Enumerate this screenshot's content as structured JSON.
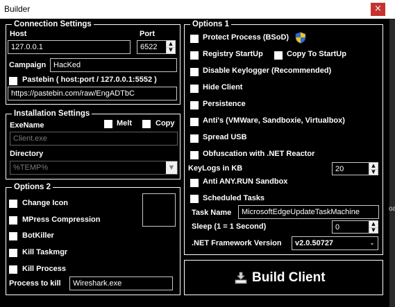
{
  "window": {
    "title": "Builder",
    "close_glyph": "×"
  },
  "edge_text": "oac",
  "connection": {
    "title": "Connection Settings",
    "host_label": "Host",
    "host_value": "127.0.0.1",
    "port_label": "Port",
    "port_value": "6522",
    "campaign_label": "Campaign",
    "campaign_value": "HacKed",
    "pastebin_label": "Pastebin ( host:port / 127.0.0.1:5552 )",
    "pastebin_url": "https://pastebin.com/raw/EngADTbC"
  },
  "installation": {
    "title": "Installation Settings",
    "exename_label": "ExeName",
    "melt_label": "Melt",
    "copy_label": "Copy",
    "exename_value": "Client.exe",
    "directory_label": "Directory",
    "directory_value": "%TEMP%"
  },
  "options2": {
    "title": "Options 2",
    "change_icon": "Change Icon",
    "mpress": "MPress Compression",
    "botkiller": "BotKiller",
    "kill_taskmgr": "Kill Taskmgr",
    "kill_process": "Kill Process",
    "process_label": "Process to kill",
    "process_value": "Wireshark.exe"
  },
  "options1": {
    "title": "Options 1",
    "protect_process": "Protect Process (BSoD)",
    "registry_startup": "Registry StartUp",
    "copy_to_startup": "Copy To StartUp",
    "disable_keylogger": "Disable Keylogger (Recommended)",
    "hide_client": "Hide Client",
    "persistence": "Persistence",
    "antis": "Anti's (VMWare, Sandboxie, Virtualbox)",
    "spread_usb": "Spread USB",
    "obfuscation": "Obfuscation with .NET Reactor",
    "keylogs_label": "KeyLogs in KB",
    "keylogs_value": "20",
    "anti_anyrun": "Anti ANY.RUN Sandbox",
    "scheduled_tasks": "Scheduled Tasks",
    "task_name_label": "Task Name",
    "task_name_value": "MicrosoftEdgeUpdateTaskMachine",
    "sleep_label": "Sleep (1 = 1 Second)",
    "sleep_value": "0",
    "framework_label": ".NET Framework Version",
    "framework_value": "v2.0.50727"
  },
  "build": {
    "label": "Build Client"
  },
  "colors": {
    "background": "#000000",
    "close": "#c6322f",
    "text": "#ffffff",
    "shield_blue": "#2e6fd8",
    "shield_yellow": "#f2c318"
  }
}
